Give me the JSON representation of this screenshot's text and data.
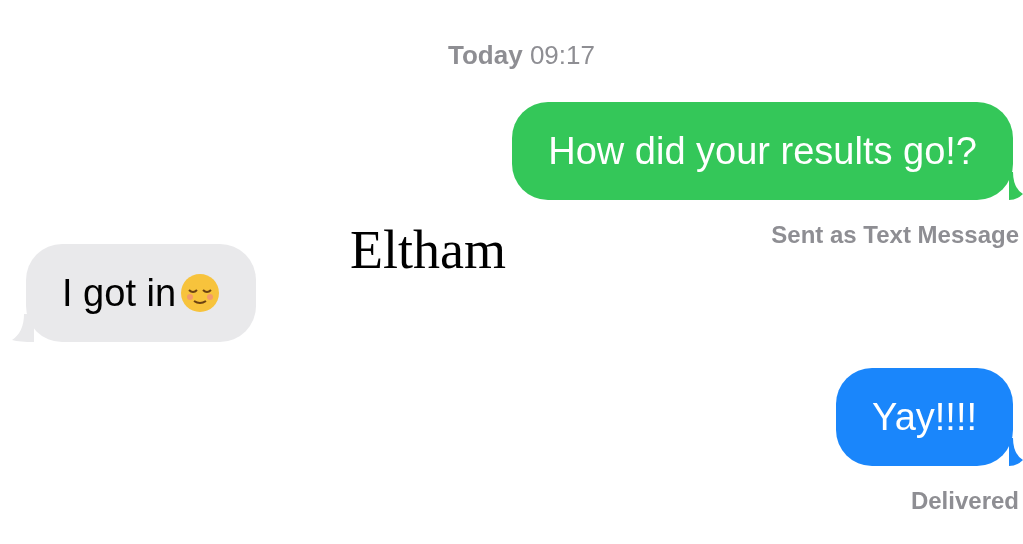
{
  "timestamp": {
    "day": "Today",
    "time": "09:17"
  },
  "caption": "Eltham",
  "messages": [
    {
      "kind": "sms",
      "text": "How did your results go!?",
      "status": "Sent as Text Message"
    },
    {
      "kind": "received",
      "text": "I got in",
      "emoji": true
    },
    {
      "kind": "imessage",
      "text": "Yay!!!!",
      "status": "Delivered"
    }
  ]
}
